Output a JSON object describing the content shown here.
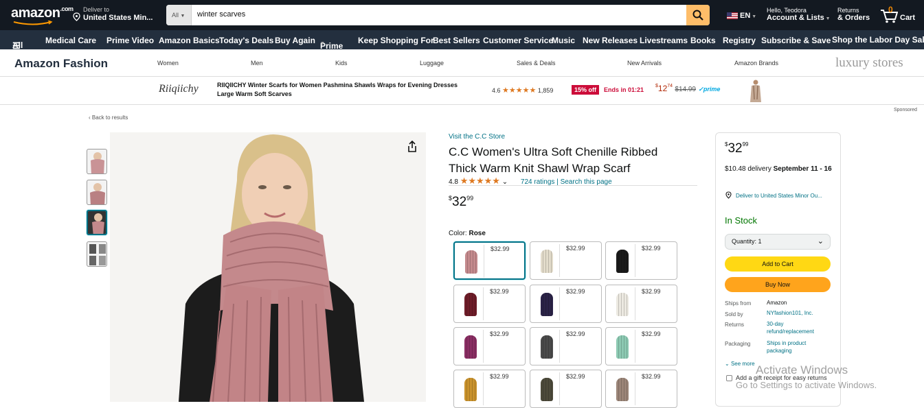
{
  "header": {
    "logo": "amazon",
    "deliver_line1": "Deliver to",
    "deliver_line2": "United States Min...",
    "search_category": "All",
    "search_value": "winter scarves",
    "language": "EN",
    "account_line1": "Hello, Teodora",
    "account_line2": "Account & Lists",
    "returns_line1": "Returns",
    "returns_line2": "& Orders",
    "cart_count": "0",
    "cart_label": "Cart"
  },
  "nav": {
    "all_label": "All",
    "items": [
      "Medical Care",
      "Prime Video",
      "Amazon Basics",
      "Today's Deals",
      "Buy Again",
      "Prime",
      "Keep Shopping For",
      "Best Sellers",
      "Customer Service",
      "Music",
      "New Releases",
      "Livestreams",
      "Books",
      "Registry",
      "Subscribe & Save"
    ],
    "promo_label": "Shop the Labor Day Sale"
  },
  "fashion_bar": {
    "title": "Amazon Fashion",
    "categories": [
      "Women",
      "Men",
      "Kids",
      "Luggage",
      "Sales & Deals",
      "New Arrivals",
      "Amazon Brands"
    ],
    "luxury": "luxury stores"
  },
  "promo": {
    "brand": "Riiqiichy",
    "title_line1": "RIIQIICHY Winter Scarfs for Women Pashmina Shawls Wraps for Evening Dresses",
    "title_line2": "Large Warm Soft Scarves",
    "rating": "4.6",
    "review_count": "1,859",
    "discount": "15% off",
    "ends_in": "Ends in 01:21",
    "price_dollars": "12",
    "price_cents": "74",
    "list_price": "$14.99",
    "prime": "prime",
    "sponsored": "Sponsored"
  },
  "breadcrumb": {
    "back": "‹ Back to results"
  },
  "product": {
    "store_link": "Visit the C.C Store",
    "title_line1": "C.C Women's Ultra Soft Chenille Ribbed",
    "title_line2": "Thick Warm Knit Shawl Wrap Scarf",
    "rating": "4.8",
    "stars": "★★★★★",
    "ratings_count": "724 ratings",
    "separator": "|",
    "search_page": "Search this page",
    "price_symbol": "$",
    "price_dollars": "32",
    "price_cents": "99",
    "color_label": "Color:",
    "color_value": "Rose",
    "swatches": [
      {
        "price": "$32.99",
        "color": "#c48a8d"
      },
      {
        "price": "$32.99",
        "color": "#e3dccb"
      },
      {
        "price": "$32.99",
        "color": "#1a1a1a"
      },
      {
        "price": "$32.99",
        "color": "#6e1c28"
      },
      {
        "price": "$32.99",
        "color": "#2b2347"
      },
      {
        "price": "$32.99",
        "color": "#ece9e1"
      },
      {
        "price": "$32.99",
        "color": "#8a2e63"
      },
      {
        "price": "$32.99",
        "color": "#4a4a4a"
      },
      {
        "price": "$32.99",
        "color": "#8cc9b2"
      },
      {
        "price": "$32.99",
        "color": "#c9922c"
      },
      {
        "price": "$32.99",
        "color": "#4d4a3a"
      },
      {
        "price": "$32.99",
        "color": "#9b8578"
      }
    ]
  },
  "buybox": {
    "price_symbol": "$",
    "price_dollars": "32",
    "price_cents": "99",
    "delivery_prefix": "$10.48 delivery",
    "delivery_dates": "September 11 - 16",
    "deliver_to": "Deliver to United States Minor Ou...",
    "stock": "In Stock",
    "quantity": "Quantity: 1",
    "add_to_cart": "Add to Cart",
    "buy_now": "Buy Now",
    "ships_from_label": "Ships from",
    "ships_from_value": "Amazon",
    "sold_by_label": "Sold by",
    "sold_by_value": "NYfashion101, Inc.",
    "returns_label": "Returns",
    "returns_value": "30-day refund/replacement",
    "packaging_label": "Packaging",
    "packaging_value": "Ships in product packaging",
    "see_more": "See more",
    "gift_receipt": "Add a gift receipt for easy returns"
  },
  "watermark": {
    "line1": "Activate Windows",
    "line2": "Go to Settings to activate Windows."
  }
}
